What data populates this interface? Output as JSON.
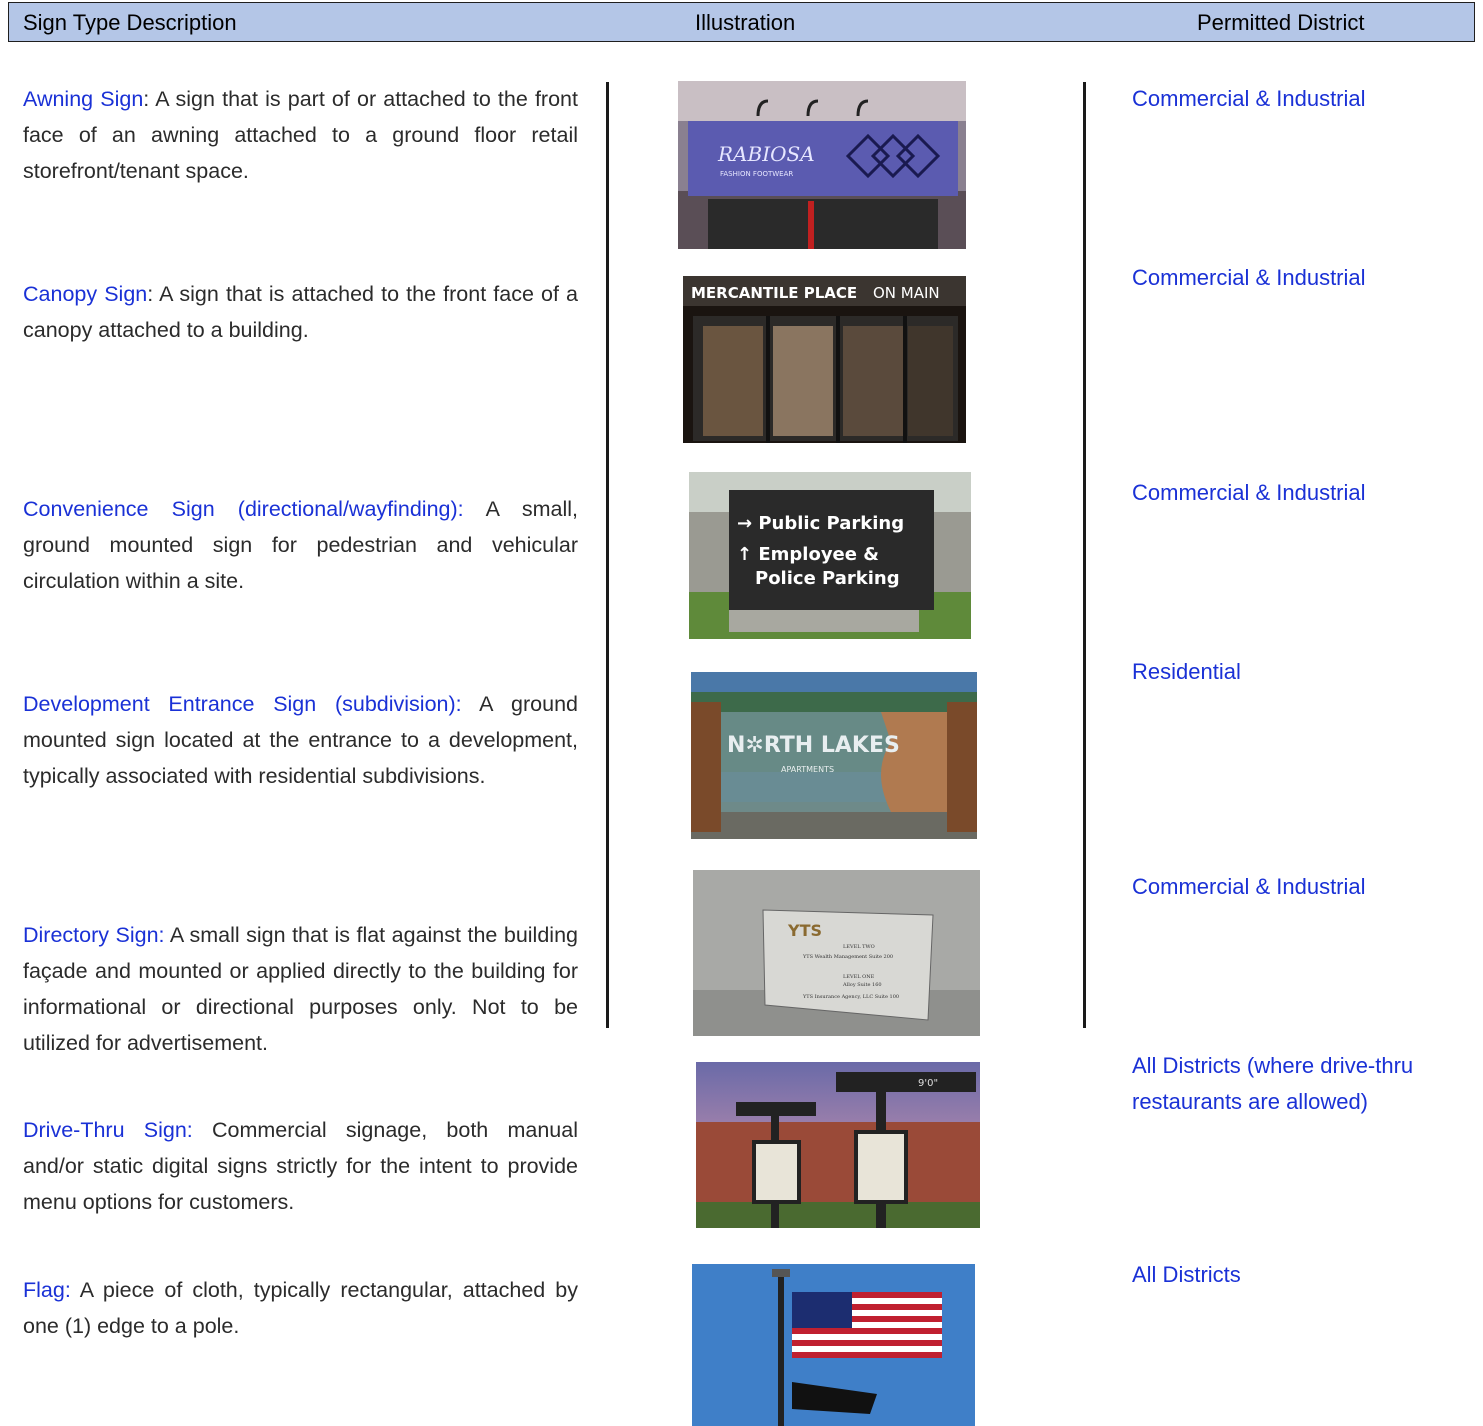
{
  "header": {
    "col1": "Sign Type Description",
    "col2": "Illustration",
    "col3": "Permitted District"
  },
  "rows": [
    {
      "term": "Awning Sign",
      "sep": ":",
      "definition": " A sign that is part of or attached to the front face of an awning attached to a ground floor retail storefront/tenant space.",
      "district": "Commercial & Industrial",
      "photo_text": [
        "RABIOSA",
        "FASHION FOOTWEAR"
      ]
    },
    {
      "term": "Canopy Sign",
      "sep": ":",
      "definition": " A sign that is attached to the front face of a canopy attached to a building.",
      "district": "Commercial & Industrial",
      "photo_text": [
        "MERCANTILE PLACE",
        "ON MAIN"
      ]
    },
    {
      "term": "Convenience Sign (directional/wayfinding):",
      "sep": "",
      "definition": " A small, ground mounted sign for pedestrian and vehicular circulation within a site.",
      "district": "Commercial & Industrial",
      "photo_text": [
        "→ Public Parking",
        "↑ Employee &",
        "Police Parking"
      ]
    },
    {
      "term": "Development Entrance Sign (subdivision):",
      "sep": "",
      "definition": " A ground mounted sign located at the entrance to a development, typically associated with residential subdivisions.",
      "district": "Residential",
      "photo_text": [
        "N✲RTH LAKES",
        "APARTMENTS"
      ]
    },
    {
      "term": "Directory Sign:",
      "sep": "",
      "definition": " A small sign that is flat against the building façade and mounted or applied directly to the building for informational or directional purposes only.  Not to be utilized for advertisement.",
      "district": "Commercial & Industrial",
      "photo_text": [
        "YTS",
        "LEVEL TWO",
        "YTS Wealth Management Suite 200",
        "LEVEL ONE",
        "Alloy Suite 160",
        "YTS Insurance Agency, LLC Suite 100"
      ]
    },
    {
      "term": "Drive-Thru Sign:",
      "sep": "",
      "definition": " Commercial signage, both manual and/or static digital signs strictly for the intent to provide menu options for customers.",
      "district": "All Districts (where drive-thru restaurants are allowed)",
      "photo_text": [
        "9'0\""
      ]
    },
    {
      "term": "Flag:",
      "sep": "",
      "definition": " A piece of cloth, typically rectangular, attached by one (1) edge to a pole.",
      "district": "All Districts",
      "photo_text": []
    }
  ]
}
